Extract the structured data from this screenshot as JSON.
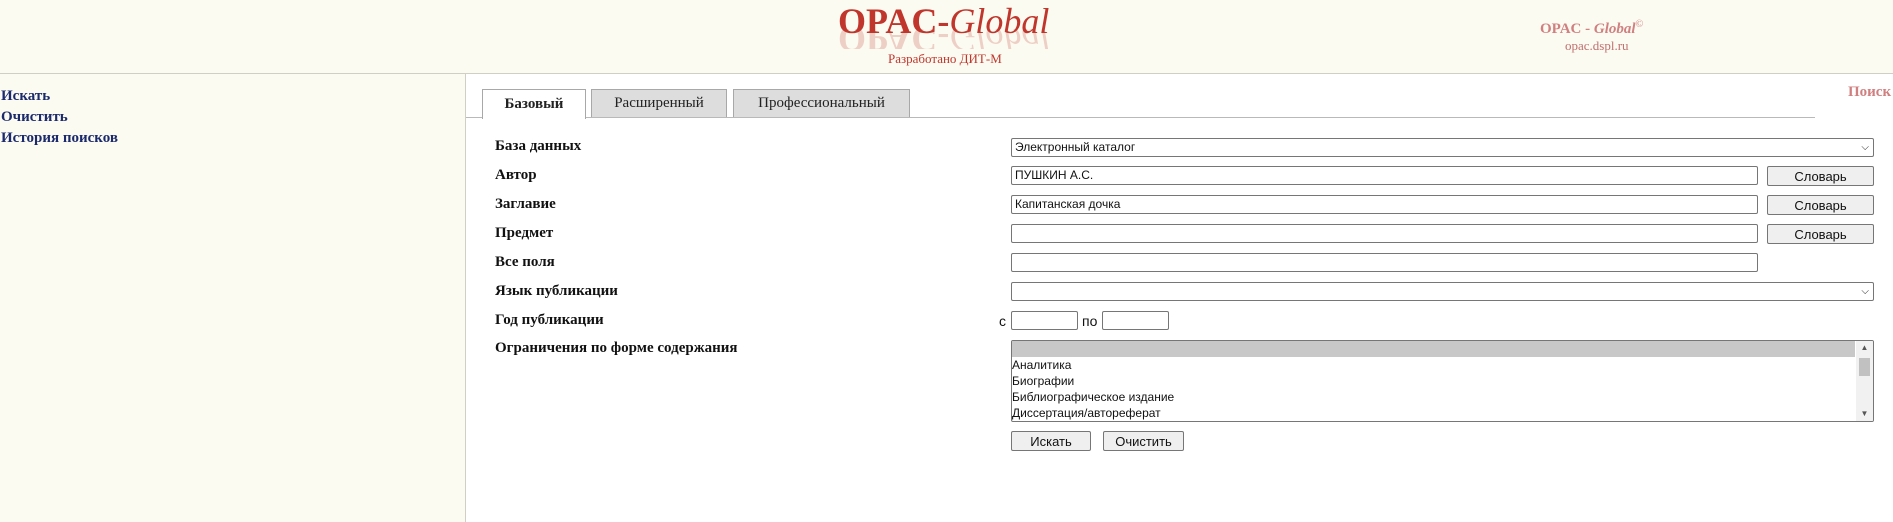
{
  "header": {
    "logo_part1": "OPAC-",
    "logo_part2": "Global",
    "developer": "Разработано ДИТ-М",
    "brand_part1": "OPAC - ",
    "brand_part2": "Global",
    "brand_mark": "©",
    "site": "opac.dspl.ru"
  },
  "sidebar": {
    "items": [
      {
        "label": "Искать"
      },
      {
        "label": "Очистить"
      },
      {
        "label": "История поисков"
      }
    ]
  },
  "tabs": [
    {
      "label": "Базовый",
      "active": true
    },
    {
      "label": "Расширенный",
      "active": false
    },
    {
      "label": "Профессиональный",
      "active": false
    }
  ],
  "search_link": "Поиск",
  "form": {
    "database": {
      "label": "База данных",
      "value": "Электронный каталог"
    },
    "author": {
      "label": "Автор",
      "value": "ПУШКИН А.С."
    },
    "title": {
      "label": "Заглавие",
      "value": "Капитанская дочка"
    },
    "subject": {
      "label": "Предмет",
      "value": ""
    },
    "all_fields": {
      "label": "Все поля",
      "value": ""
    },
    "language": {
      "label": "Язык публикации",
      "value": ""
    },
    "year": {
      "label": "Год публикации",
      "from_label": "с",
      "to_label": "по",
      "from": "",
      "to": ""
    },
    "content_form": {
      "label": "Ограничения по форме содержания",
      "options": [
        "",
        "Аналитика",
        "Биографии",
        "Библиографическое издание",
        "Диссертация/автореферат"
      ]
    },
    "dictionary_label": "Словарь",
    "search_button": "Искать",
    "clear_button": "Очистить"
  },
  "icons": {
    "dropdown": "chevron-down-icon",
    "scroll_up": "scroll-up-icon",
    "scroll_down": "scroll-down-icon"
  }
}
